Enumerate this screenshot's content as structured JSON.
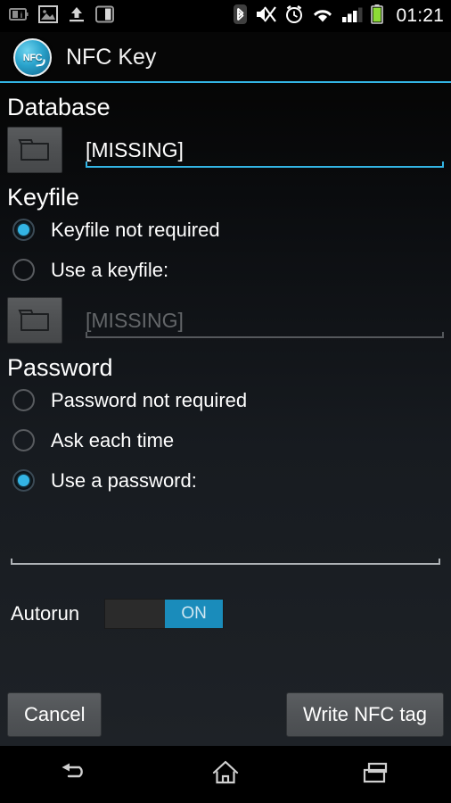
{
  "statusbar": {
    "time": "01:21",
    "left_icons": [
      {
        "name": "battery-info-icon"
      },
      {
        "name": "image-icon"
      },
      {
        "name": "upload-icon"
      },
      {
        "name": "sd-card-icon"
      }
    ],
    "right_icons": [
      {
        "name": "bluetooth-icon"
      },
      {
        "name": "mute-icon"
      },
      {
        "name": "alarm-clock-icon"
      },
      {
        "name": "wifi-icon"
      },
      {
        "name": "cellular-signal-icon"
      },
      {
        "name": "battery-icon"
      }
    ]
  },
  "titlebar": {
    "app_name": "NFC Key",
    "logo_text": "NFC",
    "accent_color": "#33b5e5"
  },
  "database": {
    "header": "Database",
    "browse_icon": "folder-icon",
    "path_value": "[MISSING]",
    "underline_color": "#33b5e5"
  },
  "keyfile": {
    "header": "Keyfile",
    "options": [
      {
        "label": "Keyfile not required",
        "selected": true
      },
      {
        "label": "Use a keyfile:",
        "selected": false
      }
    ],
    "browse_icon": "folder-icon",
    "path_value": "[MISSING]",
    "path_disabled": true,
    "underline_color": "#55585c"
  },
  "password": {
    "header": "Password",
    "options": [
      {
        "label": "Password not required",
        "selected": false
      },
      {
        "label": "Ask each time",
        "selected": false
      },
      {
        "label": "Use a password:",
        "selected": true
      }
    ],
    "input_value": "",
    "underline_color": "#aeb2b6"
  },
  "autorun": {
    "label": "Autorun",
    "state_label": "ON",
    "checked": true,
    "thumb_color": "#1a8cbb"
  },
  "buttons": {
    "cancel": "Cancel",
    "write": "Write NFC tag"
  },
  "navbar": {
    "back": "back-icon",
    "home": "home-icon",
    "recents": "recents-icon"
  }
}
